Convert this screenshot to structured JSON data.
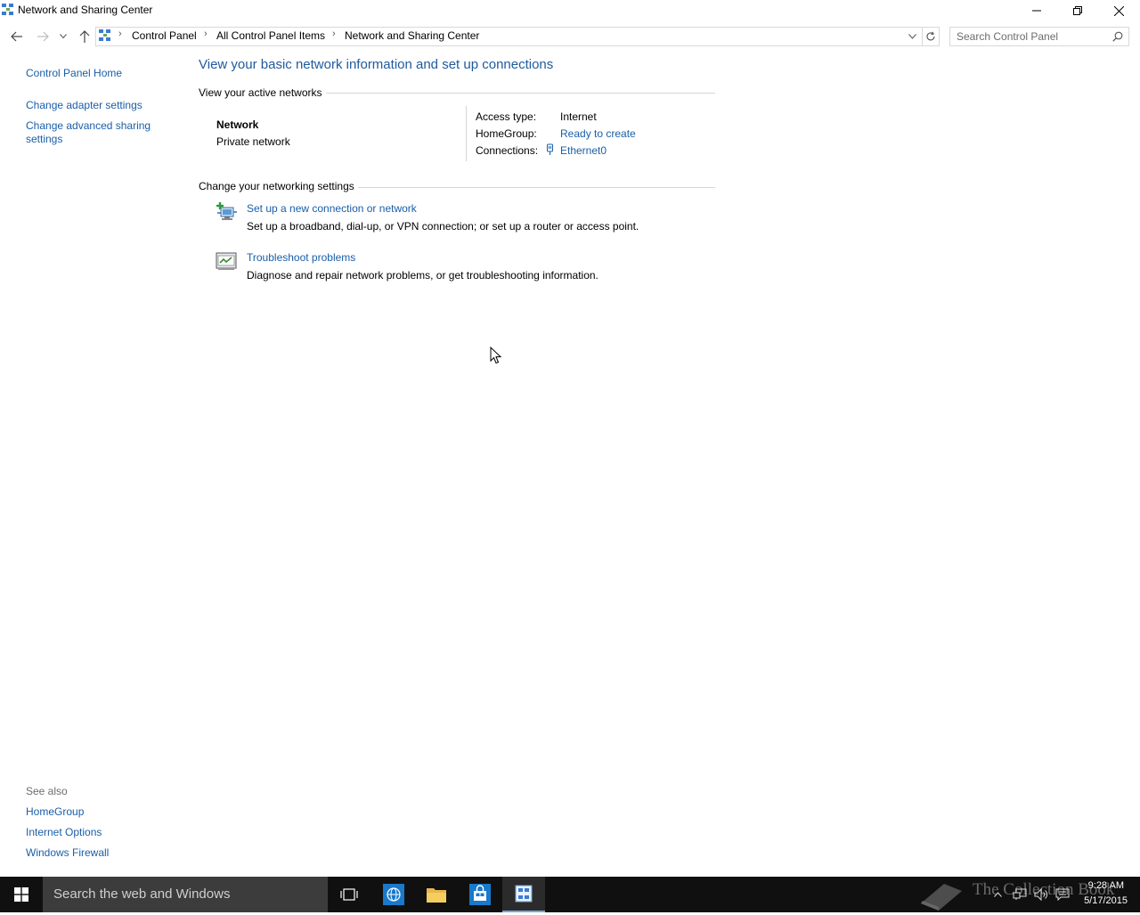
{
  "window": {
    "title": "Network and Sharing Center"
  },
  "address": {
    "crumbs": [
      "Control Panel",
      "All Control Panel Items",
      "Network and Sharing Center"
    ]
  },
  "search": {
    "placeholder": "Search Control Panel"
  },
  "sidebar": {
    "items": [
      {
        "label": "Control Panel Home"
      },
      {
        "label": "Change adapter settings"
      },
      {
        "label": "Change advanced sharing"
      },
      {
        "label": "settings"
      }
    ],
    "see_also_label": "See also",
    "see_also": [
      {
        "label": "HomeGroup"
      },
      {
        "label": "Internet Options"
      },
      {
        "label": "Windows Firewall"
      }
    ]
  },
  "main": {
    "heading": "View your basic network information and set up connections",
    "active_networks_title": "View your active networks",
    "network": {
      "name": "Network",
      "type": "Private network",
      "access_type_label": "Access type:",
      "access_type_value": "Internet",
      "homegroup_label": "HomeGroup:",
      "homegroup_value": "Ready to create",
      "connections_label": "Connections:",
      "connections_value": "Ethernet0"
    },
    "change_settings_title": "Change your networking settings",
    "tasks": [
      {
        "title": "Set up a new connection or network",
        "description": "Set up a broadband, dial-up, or VPN connection; or set up a router or access point.",
        "icon": "network-setup-icon"
      },
      {
        "title": "Troubleshoot problems",
        "description": "Diagnose and repair network problems, or get troubleshooting information.",
        "icon": "troubleshoot-icon"
      }
    ]
  },
  "taskbar": {
    "search_placeholder": "Search the web and Windows",
    "watermark": "The Collection Book",
    "time": "9:28 AM",
    "date": "5/17/2015",
    "icons": [
      "task-view-icon",
      "internet-explorer-icon",
      "file-explorer-icon",
      "store-icon",
      "control-panel-icon"
    ]
  },
  "colors": {
    "link": "#1a5ea8",
    "heading": "#1e5a9e",
    "taskbar": "#101010"
  }
}
